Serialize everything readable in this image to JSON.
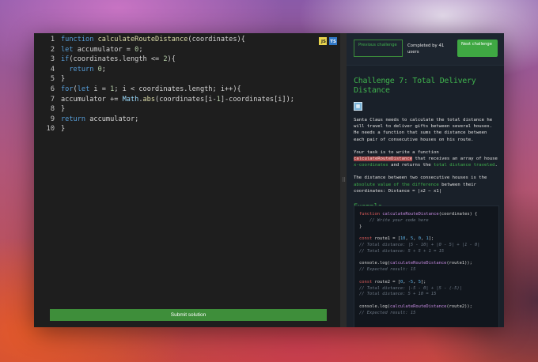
{
  "editor": {
    "lines": [
      {
        "n": "1",
        "t": "function calculateRouteDistance(coordinates){"
      },
      {
        "n": "2",
        "t": "let accumulator = 0;"
      },
      {
        "n": "3",
        "t": "if(coordinates.length <= 2){"
      },
      {
        "n": "4",
        "t": "  return 0;"
      },
      {
        "n": "5",
        "t": "}"
      },
      {
        "n": "6",
        "t": "for(let i = 1; i < coordinates.length; i++){"
      },
      {
        "n": "7",
        "t": "accumulator += Math.abs(coordinates[i-1]-coordinates[i]);"
      },
      {
        "n": "8",
        "t": "}"
      },
      {
        "n": "9",
        "t": "return accumulator;"
      },
      {
        "n": "10",
        "t": "}"
      }
    ],
    "badge_js": "JS",
    "badge_ts": "TS",
    "submit_label": "Submit solution"
  },
  "panel": {
    "prev_label": "Previous challenge",
    "completed_text": "Completed by 41 users",
    "next_label": "Next challenge",
    "title": "Challenge 7: Total Delivery Distance",
    "p1": "Santa Claus needs to calculate the total distance he will travel to deliver gifts between several houses. He needs a function that sums the distance between each pair of consecutive houses on his route.",
    "p2_a": "Your task is to write a function ",
    "p2_hl": "calculateRouteDistance",
    "p2_b": " that receives an array of house ",
    "p2_g1": "x-coordinates",
    "p2_c": " and returns the ",
    "p2_g2": "total distance traveled",
    "p2_d": ".",
    "p3_a": "The distance between two consecutive houses is the ",
    "p3_g": "absolute value of the difference",
    "p3_b": " between their coordinates: Distance = |x2 − x1|",
    "example_title": "Example",
    "example_lines": [
      "function calculateRouteDistance(coordinates) {",
      "    // Write your code here",
      "}",
      "",
      "const route1 = [10, 5, 0, 1];",
      "// Total distance: |5 - 10| + |0 - 5| + |1 - 0|",
      "// Total distance: 5 + 5 + 1 = 15",
      "",
      "console.log(calculateRouteDistance(route1));",
      "// Expected result: 15",
      "",
      "const route2 = [0, -5, 5];",
      "// Total distance: |-5 - 0| + |5 - (-5)|",
      "// Total distance: 5 + 10 = 15",
      "",
      "console.log(calculateRouteDistance(route2));",
      "// Expected result: 15"
    ]
  },
  "colors": {
    "accent": "#3fb24d",
    "submit": "#3e8e3a",
    "panel_bg": "#192029",
    "editor_bg": "#1e1e1e"
  }
}
